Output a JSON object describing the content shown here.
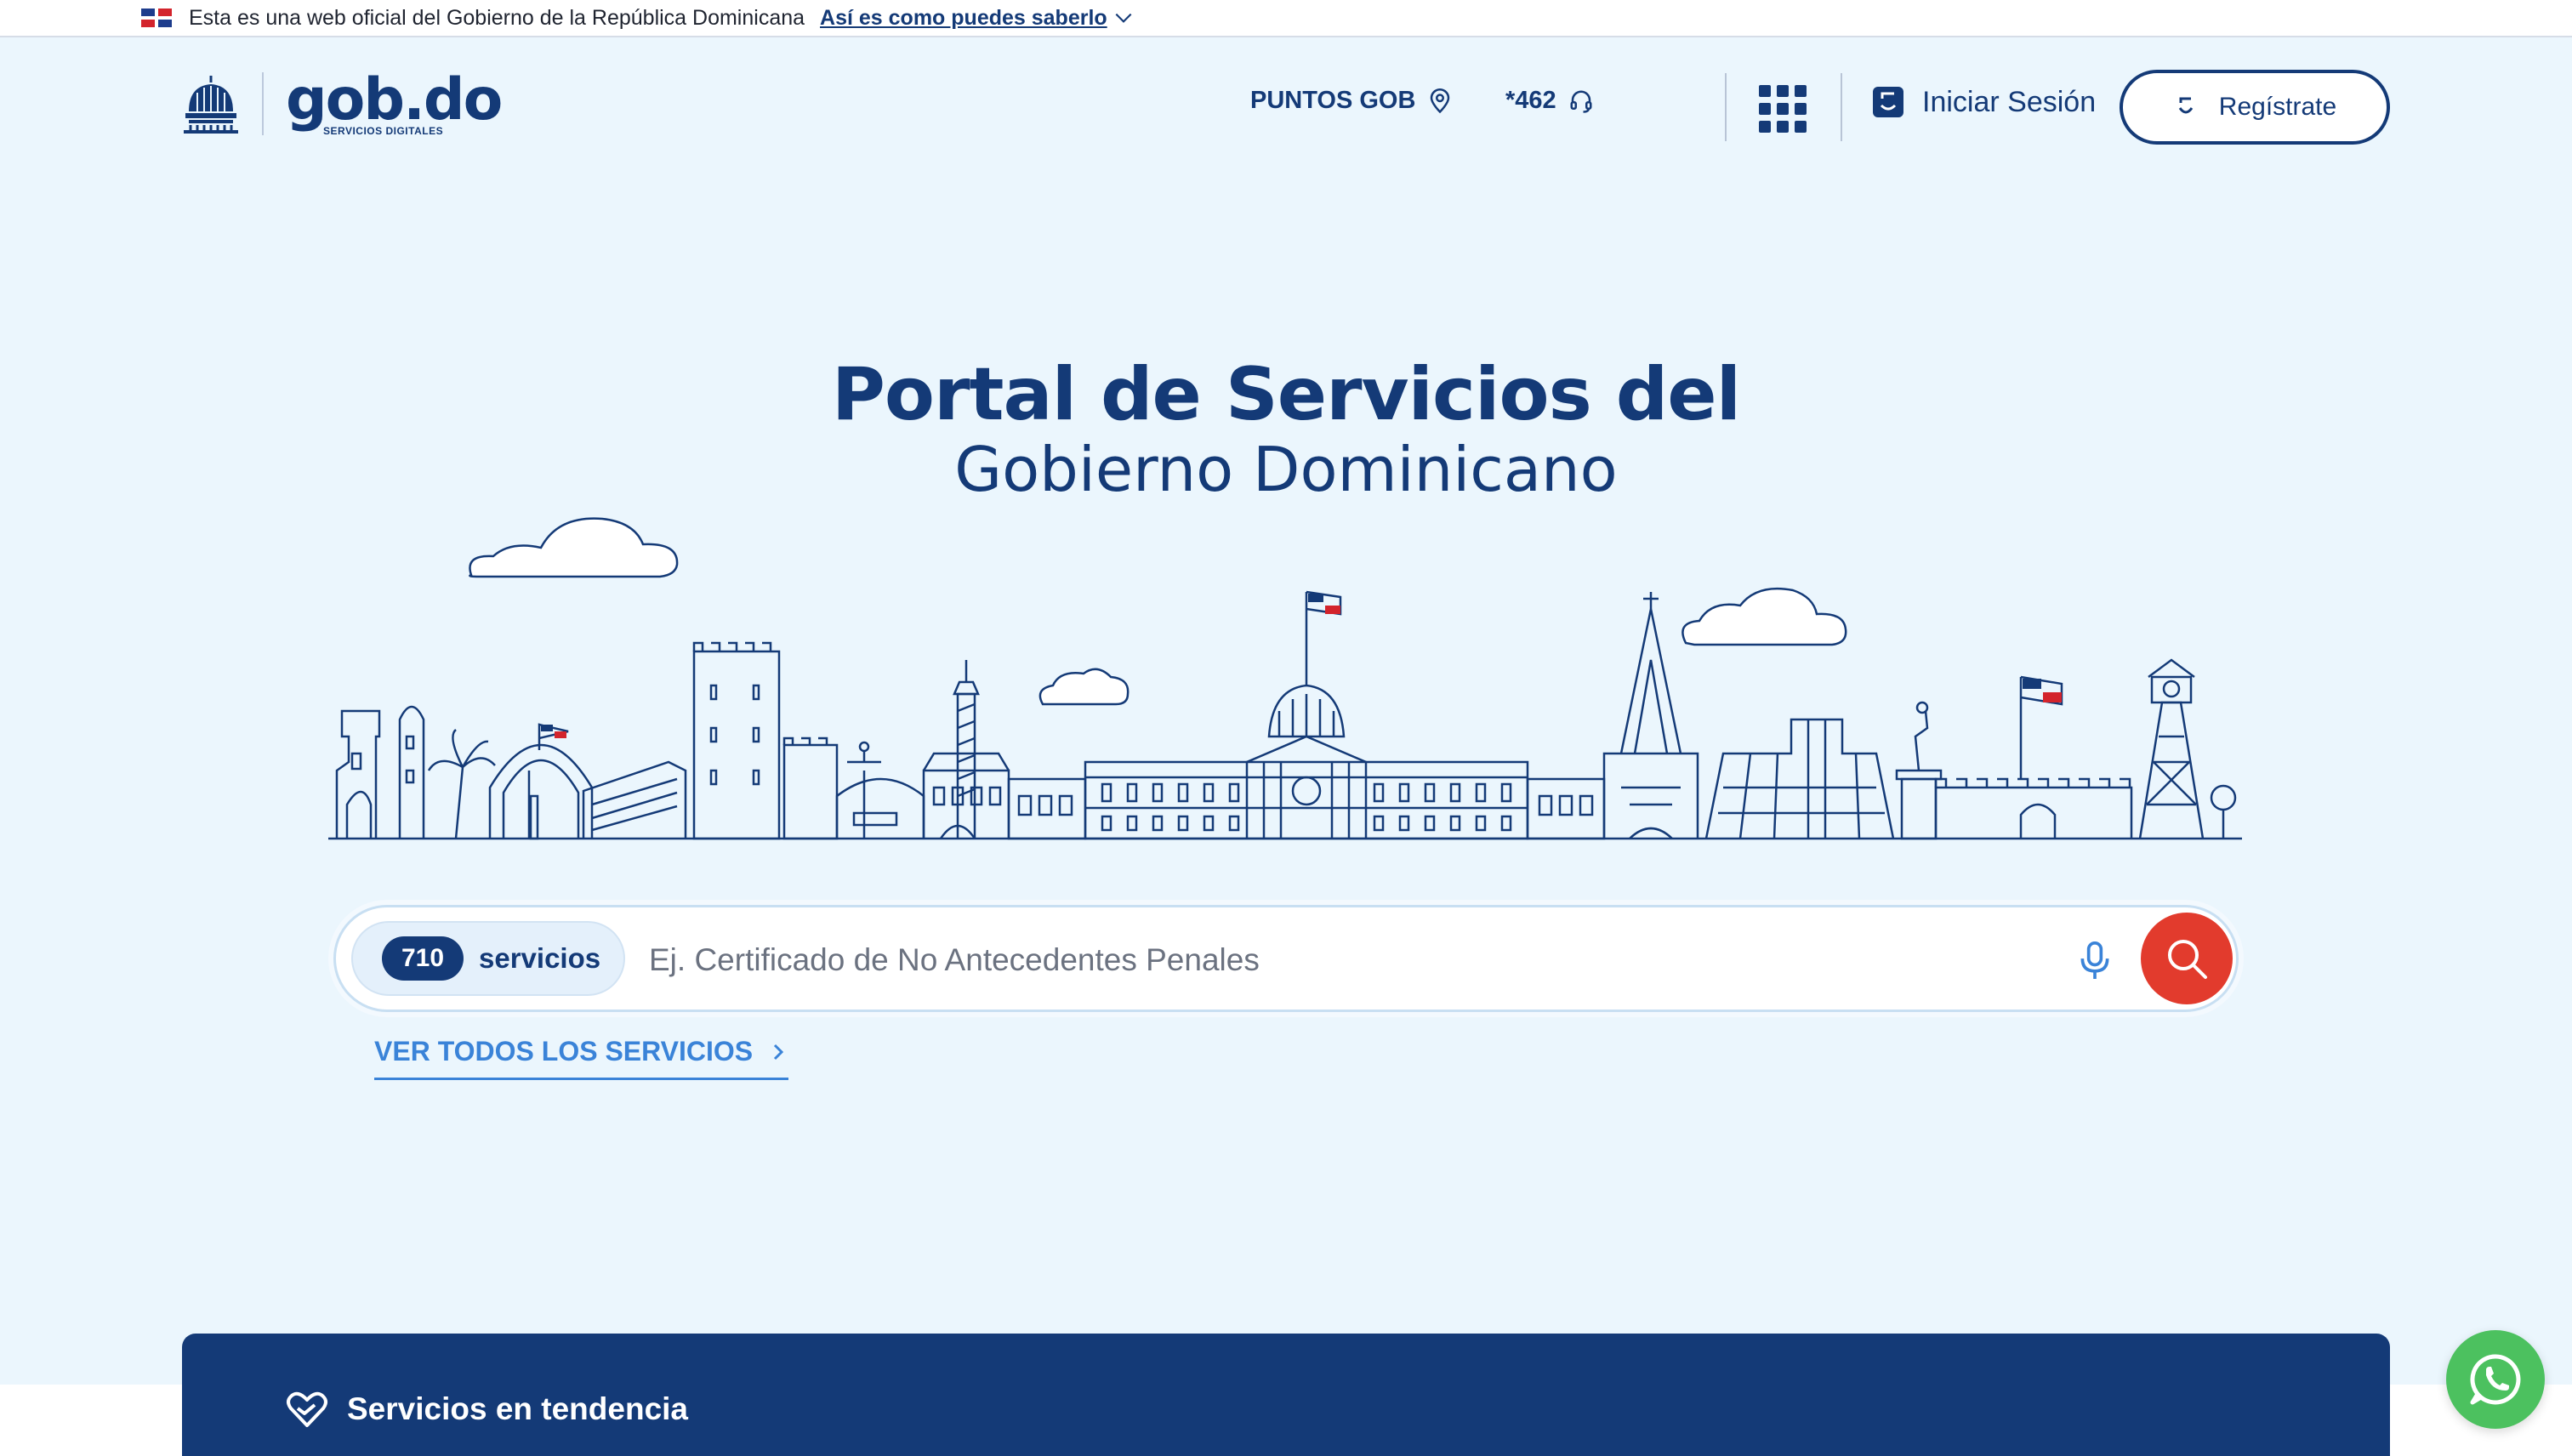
{
  "topbar": {
    "official_text": "Esta es una web oficial del Gobierno de la República Dominicana",
    "how_to_link": "Así es como puedes saberlo"
  },
  "header": {
    "logo_brand": "gob.do",
    "logo_sub": "SERVICIOS DIGITALES",
    "points_label": "PUNTOS GOB",
    "phone_label": "*462",
    "login_label": "Iniciar Sesión",
    "register_label": "Regístrate"
  },
  "hero": {
    "title_line1": "Portal de Servicios del",
    "title_line2": "Gobierno Dominicano"
  },
  "search": {
    "count": "710",
    "count_label": "servicios",
    "placeholder": "Ej. Certificado de No Antecedentes Penales"
  },
  "see_all_label": "VER TODOS LOS SERVICIOS",
  "trending": {
    "title": "Servicios en tendencia"
  },
  "icons": {
    "flag": "dominican-flag-icon",
    "chevron": "chevron-down-icon",
    "location": "location-pin-icon",
    "headset": "headset-icon",
    "apps": "apps-grid-icon",
    "login": "login-icon",
    "register": "user-icon",
    "mic": "microphone-icon",
    "search": "search-icon",
    "heart": "heart-hand-icon",
    "whatsapp": "whatsapp-icon"
  },
  "colors": {
    "primary": "#143a77",
    "background": "#ebf6fd",
    "accent_red": "#e23b2d",
    "link_blue": "#3a83d8",
    "whatsapp_green": "#4cc15f"
  }
}
